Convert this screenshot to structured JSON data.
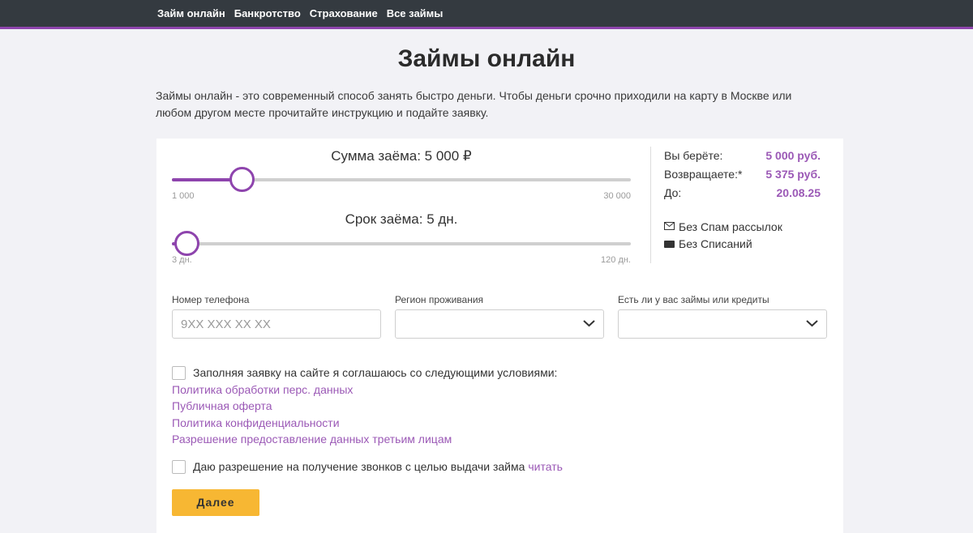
{
  "nav": [
    "Займ онлайн",
    "Банкротство",
    "Страхование",
    "Все займы"
  ],
  "page_title": "Займы онлайн",
  "intro": "Займы онлайн - это современный способ занять быстро деньги. Чтобы деньги срочно приходили на карту в Москве или любом другом месте прочитайте инструкцию и подайте заявку.",
  "amount_slider": {
    "title": "Сумма заёма: 5 000 ₽",
    "min_label": "1 000",
    "max_label": "30 000",
    "min": 1000,
    "max": 30000,
    "value": 5000
  },
  "term_slider": {
    "title": "Срок заёма: 5 дн.",
    "min_label": "3 дн.",
    "max_label": "120 дн.",
    "min": 3,
    "max": 120,
    "value": 5
  },
  "summary": {
    "take_label": "Вы берёте:",
    "take_value": "5 000 руб.",
    "return_label": "Возвращаете:*",
    "return_value": "5 375 руб.",
    "until_label": "До:",
    "until_value": "20.08.25",
    "feature_1": "Без Спам рассылок",
    "feature_2": "Без Списаний"
  },
  "form": {
    "phone_label": "Номер телефона",
    "phone_placeholder": "9XX XXX XX XX",
    "region_label": "Регион проживания",
    "region_value": "",
    "loans_label": "Есть ли у вас займы или кредиты",
    "loans_value": ""
  },
  "consent": {
    "text": "Заполняя заявку на сайте я соглашаюсь со следующими условиями:",
    "links": [
      "Политика обработки перс. данных",
      "Публичная оферта",
      "Политика конфиденциальности",
      "Разрешение предоставление данных третьим лицам"
    ],
    "calls_text": "Даю разрешение на получение звонков с целью выдачи займа",
    "calls_link": "читать"
  },
  "submit_label": "Далее",
  "accent_color": "#8e44ad",
  "button_color": "#f7b733",
  "icons": [
    "envelope-icon",
    "card-icon",
    "chevron-down-icon"
  ]
}
